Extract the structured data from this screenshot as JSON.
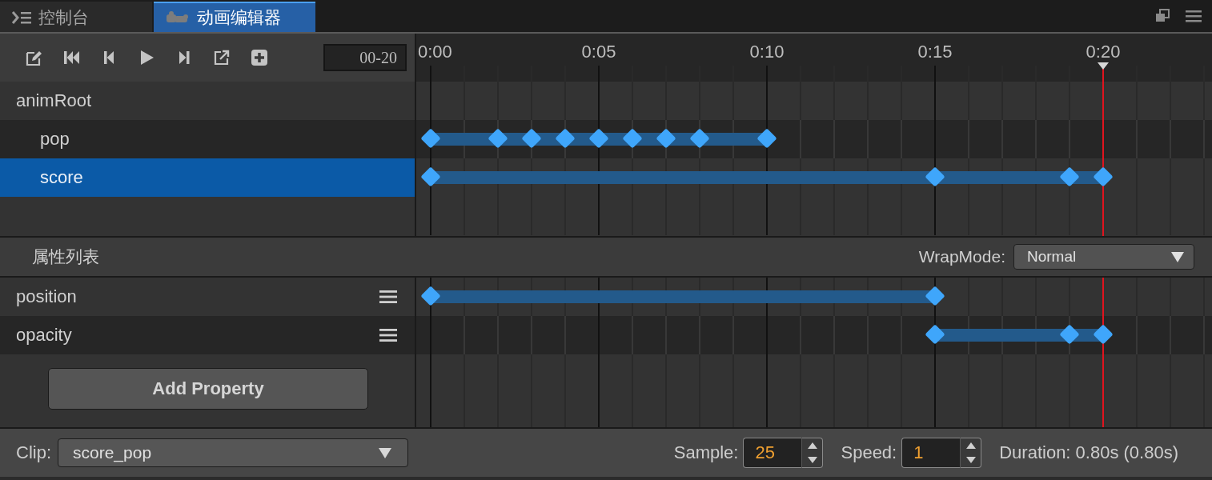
{
  "tabs": [
    {
      "label": "控制台",
      "kind": "console",
      "selected": false
    },
    {
      "label": "动画编辑器",
      "kind": "animation",
      "selected": true
    }
  ],
  "toolbar": {
    "frame_field": "00-20"
  },
  "timeline": {
    "ruler": [
      {
        "label": "0:00",
        "playhead": false
      },
      {
        "label": "0:05",
        "playhead": false
      },
      {
        "label": "0:10",
        "playhead": false
      },
      {
        "label": "0:15",
        "playhead": false
      },
      {
        "label": "0:20",
        "playhead": true
      }
    ]
  },
  "nodes": [
    {
      "name": "animRoot",
      "selected": false,
      "children": [
        {
          "name": "pop",
          "selected": false,
          "keys": [
            true,
            false,
            true,
            true,
            true,
            true,
            true,
            true,
            true,
            false,
            true,
            false,
            false,
            false,
            false,
            false,
            false,
            false,
            false,
            false,
            false
          ]
        },
        {
          "name": "score",
          "selected": true,
          "keys": [
            true,
            false,
            false,
            false,
            false,
            false,
            false,
            false,
            false,
            false,
            false,
            false,
            false,
            false,
            false,
            true,
            false,
            false,
            false,
            true,
            true
          ]
        }
      ]
    }
  ],
  "properties": {
    "title": "属性列表",
    "wrap_mode_label": "WrapMode:",
    "wrap_mode": "Normal",
    "items": [
      {
        "name": "position",
        "keys": [
          true,
          false,
          false,
          false,
          false,
          false,
          false,
          false,
          false,
          false,
          false,
          false,
          false,
          false,
          false,
          true,
          false,
          false,
          false,
          false,
          false
        ]
      },
      {
        "name": "opacity",
        "keys": [
          false,
          false,
          false,
          false,
          false,
          false,
          false,
          false,
          false,
          false,
          false,
          false,
          false,
          false,
          false,
          true,
          false,
          false,
          false,
          true,
          true
        ]
      }
    ],
    "add_button": "Add Property"
  },
  "footer": {
    "clip_label": "Clip:",
    "clip": "score_pop",
    "sample_label": "Sample:",
    "sample": "25",
    "speed_label": "Speed:",
    "speed": "1",
    "duration": "Duration: 0.80s (0.80s)"
  }
}
